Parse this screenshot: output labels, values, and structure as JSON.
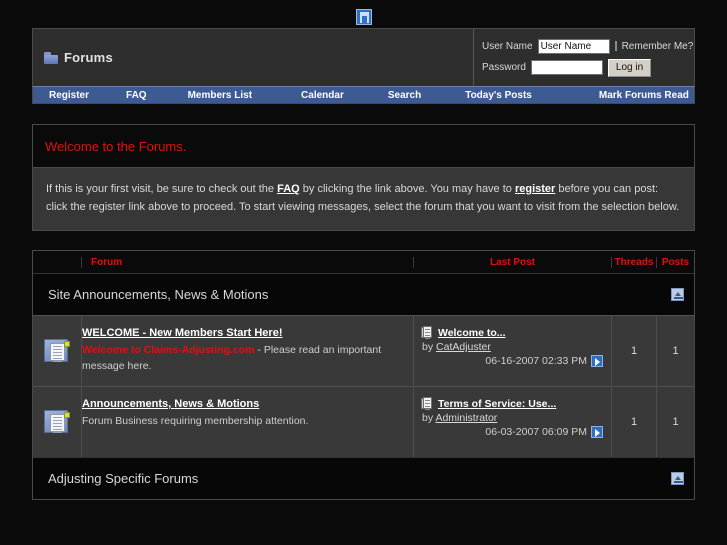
{
  "top": {
    "broken_image_alt": "broken-image"
  },
  "header": {
    "logo_icon": "forums-folder-icon",
    "title": "Forums",
    "login": {
      "username_label": "User Name",
      "username_value": "User Name",
      "password_label": "Password",
      "password_value": "",
      "remember_label": "Remember Me?",
      "login_button": "Log in"
    }
  },
  "nav": {
    "items": [
      {
        "label": "Register"
      },
      {
        "label": "FAQ"
      },
      {
        "label": "Members List"
      },
      {
        "label": "Calendar"
      },
      {
        "label": "Search"
      },
      {
        "label": "Today's Posts"
      },
      {
        "label": "Mark Forums Read"
      }
    ]
  },
  "welcome": {
    "heading": "Welcome to the Forums.",
    "text_1": "If this is your first visit, be sure to check out the ",
    "faq_link": "FAQ",
    "text_2": " by clicking the link above. You may have to ",
    "register_link": "register",
    "text_3": " before you can post: click the register link above to proceed. To start viewing messages, select the forum that you want to visit from the selection below."
  },
  "forum_table": {
    "columns": {
      "forum": "Forum",
      "last_post": "Last Post",
      "threads": "Threads",
      "posts": "Posts"
    },
    "categories": [
      {
        "title": "Site Announcements, News & Motions",
        "collapse_icon": "collapse-icon",
        "forums": [
          {
            "icon": "forum-folder-icon",
            "title": "WELCOME - New Members Start Here!",
            "desc_highlight": "Welcome to Claims-Adjusting.com",
            "desc_rest": " - Please read an important message here.",
            "last_post": {
              "thread_icon": "thread-icon",
              "thread_title": "Welcome to...",
              "by_label": "by ",
              "author": "CatAdjuster",
              "date": "06-16-2007 02:33 PM",
              "goto_icon": "go-to-last-post-icon"
            },
            "threads": "1",
            "posts": "1"
          },
          {
            "icon": "forum-folder-icon",
            "title": "Announcements, News & Motions",
            "desc_highlight": "",
            "desc_rest": "Forum Business requiring membership attention.",
            "last_post": {
              "thread_icon": "thread-icon",
              "thread_title": "Terms of Service: Use...",
              "by_label": "by ",
              "author": "Administrator",
              "date": "06-03-2007 06:09 PM",
              "goto_icon": "go-to-last-post-icon"
            },
            "threads": "1",
            "posts": "1"
          }
        ]
      },
      {
        "title": "Adjusting Specific Forums",
        "collapse_icon": "collapse-icon",
        "forums": []
      }
    ]
  },
  "colors": {
    "accent_red": "#e01010",
    "nav_blue": "#3d5a92",
    "panel_grey": "#373737",
    "row_grey": "#393939",
    "page_black": "#0b0b0b"
  }
}
